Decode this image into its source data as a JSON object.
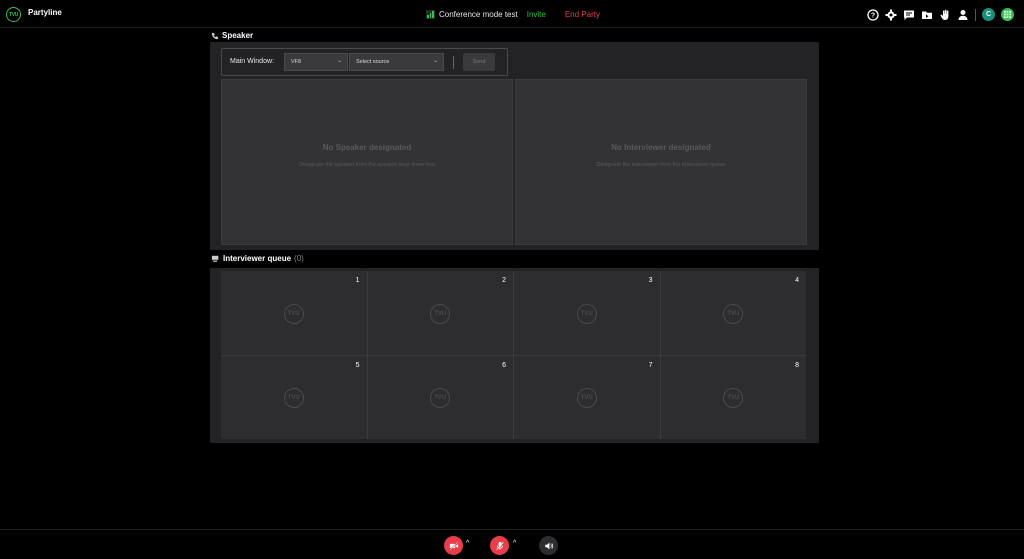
{
  "app": {
    "name": "Partyline",
    "logo_text": "TVU"
  },
  "header": {
    "conference_title": "Conference mode test",
    "invite_label": "Invite",
    "end_party_label": "End Party",
    "avatar_initial": "C",
    "icons": [
      "help-icon",
      "gear-icon",
      "chat-icon",
      "folder-icon",
      "hand-icon",
      "user-icon"
    ]
  },
  "speaker": {
    "section_title": "Speaker",
    "main_window_label": "Main Window:",
    "window_select_value": "VF8",
    "source_select_placeholder": "Select source",
    "send_label": "Send",
    "panels": [
      {
        "title": "No Speaker designated",
        "subtitle": "Designate the speaker from the speaker drop-down box"
      },
      {
        "title": "No Interviewer designated",
        "subtitle": "Designate the interviewer from the Interviewer queue"
      }
    ]
  },
  "queue": {
    "section_title": "Interviewer queue",
    "count": "(0)",
    "slots": [
      "1",
      "2",
      "3",
      "4",
      "5",
      "6",
      "7",
      "8"
    ],
    "placeholder_text": "TVU"
  },
  "colors": {
    "accent": "#33c24d",
    "danger": "#e83e4c",
    "panel": "#232326"
  }
}
